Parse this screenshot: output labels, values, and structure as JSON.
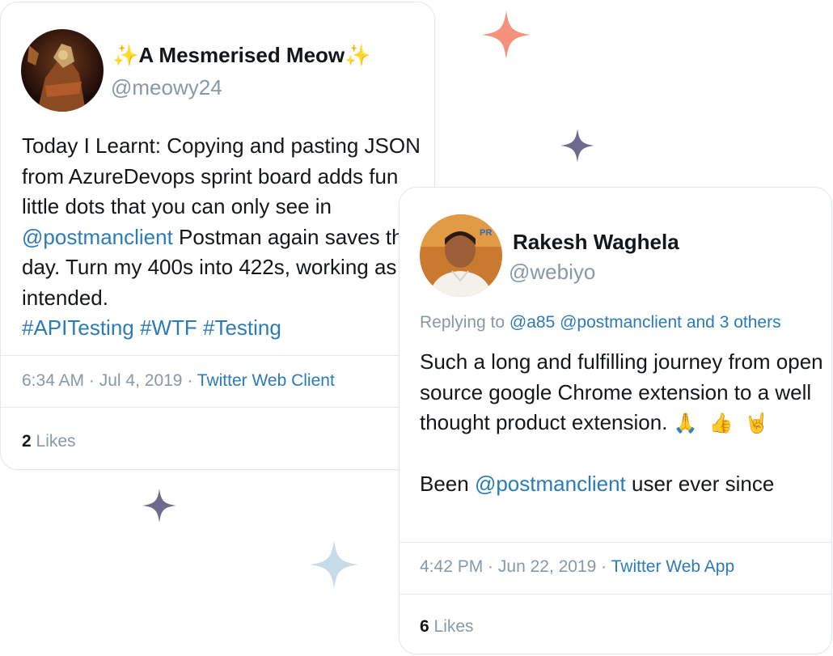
{
  "tweet1": {
    "display_name": "A Mesmerised Meow",
    "name_prefix_emoji": "✨",
    "name_suffix_emoji": "✨",
    "handle": "@meowy24",
    "text_parts": {
      "p1": "Today I Learnt: Copying and pasting JSON from AzureDevops sprint board adds fun little dots that you can only see in ",
      "mention": "@postmanclient",
      "p2": " Postman again saves the day. Turn my 400s into 422s, working as intended. ",
      "hashtag1": "#APITesting",
      "hashtag2": "#WTF",
      "hashtag3": "#Testing"
    },
    "time": "6:34 AM",
    "date": "Jul 4, 2019",
    "source": "Twitter Web Client",
    "likes_count": "2",
    "likes_label": "Likes"
  },
  "tweet2": {
    "display_name": "Rakesh Waghela",
    "handle": "@webiyo",
    "replying_label": "Replying to",
    "replying_to": "@a85 @postmanclient and 3 others",
    "text_parts": {
      "p1": "Such a long and fulfilling journey from open source google Chrome extension to a well thought product extension.",
      "emoji1": "🙏",
      "emoji2": "👍",
      "emoji3": "🤘",
      "p2_prefix": "Been ",
      "mention": "@postmanclient",
      "p2_suffix": " user ever since"
    },
    "time": "4:42 PM",
    "date": "Jun 22, 2019",
    "source": "Twitter Web App",
    "likes_count": "6",
    "likes_label": "Likes"
  },
  "colors": {
    "link": "#2b7bb9",
    "muted": "#8899a6",
    "star_orange": "#f4917a",
    "star_purple": "#6e6a8b",
    "star_blue": "#c8dbe8"
  },
  "icons": [
    "star-orange-icon",
    "star-purple-icon",
    "star-blue-icon",
    "avatar-meow",
    "avatar-rakesh"
  ]
}
